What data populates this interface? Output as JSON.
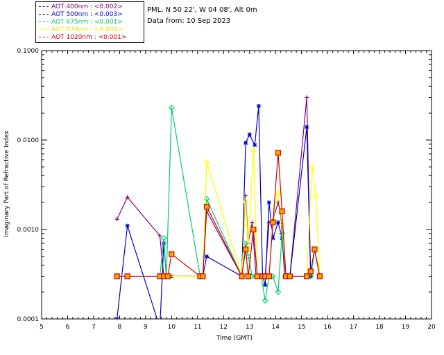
{
  "legend": [
    {
      "label": "AOT  400nm : <0.002>",
      "color": "#800080"
    },
    {
      "label": "AOT  500nm : <0.003>",
      "color": "#0000cc"
    },
    {
      "label": "AOT  675nm : <0.001>",
      "color": "#00cc66"
    },
    {
      "label": "AOT  870nm : <0.002>",
      "color": "#ffff00"
    },
    {
      "label": "AOT 1020nm : <0.001>",
      "color": "#cc0000"
    }
  ],
  "info": {
    "site": "PML, N 50 22', W 04 08', Alt 0m",
    "date": "Data from: 10 Sep 2023"
  },
  "chart_data": {
    "type": "line",
    "xlabel": "Time (GMT)",
    "ylabel": "Imaginary Part of Refractive Index",
    "xlim": [
      5,
      20
    ],
    "ylim": [
      0.0001,
      0.1
    ],
    "yscale": "log",
    "xticks": [
      "5",
      "6",
      "7",
      "8",
      "9",
      "10",
      "11",
      "12",
      "13",
      "14",
      "15",
      "16",
      "17",
      "18",
      "19",
      "20"
    ],
    "yticks": [
      "0.0001",
      "0.0010",
      "0.0100",
      "0.1000"
    ],
    "series": [
      {
        "name": "AOT  400nm",
        "color": "#800080",
        "marker": "plus",
        "points": [
          [
            7.9,
            0.0013
          ],
          [
            8.3,
            0.0023
          ],
          [
            9.55,
            0.00085
          ],
          [
            9.7,
            0.0003
          ],
          [
            9.8,
            0.0003
          ],
          [
            10.0,
            0.0003
          ],
          [
            11.1,
            0.0003
          ],
          [
            11.2,
            0.0003
          ],
          [
            11.35,
            0.0016
          ],
          [
            12.7,
            0.0003
          ],
          [
            12.85,
            0.0024
          ],
          [
            12.95,
            0.0007
          ],
          [
            13.1,
            0.0012
          ],
          [
            13.25,
            0.0003
          ],
          [
            13.45,
            0.0003
          ],
          [
            13.6,
            0.0003
          ],
          [
            13.75,
            0.0012
          ],
          [
            13.9,
            0.0013
          ],
          [
            14.1,
            0.002
          ],
          [
            14.2,
            0.0015
          ],
          [
            14.35,
            0.0003
          ],
          [
            14.55,
            0.0003
          ],
          [
            15.2,
            0.03
          ],
          [
            15.35,
            0.0003
          ],
          [
            15.5,
            0.0006
          ],
          [
            15.7,
            0.0003
          ]
        ]
      },
      {
        "name": "AOT  500nm",
        "color": "#0000cc",
        "marker": "star",
        "points": [
          [
            7.9,
            0.0001
          ],
          [
            8.3,
            0.0011
          ],
          [
            9.55,
            8e-05
          ],
          [
            9.7,
            0.0007
          ],
          [
            9.8,
            0.0003
          ],
          [
            10.0,
            0.0003
          ],
          [
            11.1,
            0.0003
          ],
          [
            11.2,
            0.0003
          ],
          [
            11.35,
            0.0005
          ],
          [
            12.7,
            0.0003
          ],
          [
            12.85,
            0.0093
          ],
          [
            13.0,
            0.0115
          ],
          [
            13.2,
            0.0088
          ],
          [
            13.35,
            0.024
          ],
          [
            13.5,
            0.0003
          ],
          [
            13.6,
            0.00024
          ],
          [
            13.75,
            0.002
          ],
          [
            13.9,
            0.0008
          ],
          [
            14.1,
            0.0012
          ],
          [
            14.25,
            0.0008
          ],
          [
            14.4,
            0.0003
          ],
          [
            14.55,
            0.0003
          ],
          [
            15.2,
            0.014
          ],
          [
            15.35,
            0.0003
          ],
          [
            15.5,
            0.0006
          ],
          [
            15.7,
            0.0003
          ]
        ]
      },
      {
        "name": "AOT  675nm",
        "color": "#00cc66",
        "marker": "diamond",
        "points": [
          [
            9.55,
            0.0003
          ],
          [
            9.7,
            0.0008
          ],
          [
            9.8,
            0.0003
          ],
          [
            10.0,
            0.023
          ],
          [
            11.1,
            0.0003
          ],
          [
            11.2,
            0.0003
          ],
          [
            11.35,
            0.0022
          ],
          [
            12.7,
            0.0003
          ],
          [
            12.85,
            0.0007
          ],
          [
            12.95,
            0.0005
          ],
          [
            13.1,
            0.0003
          ],
          [
            13.25,
            0.0003
          ],
          [
            13.45,
            0.0003
          ],
          [
            13.6,
            0.00016
          ],
          [
            13.75,
            0.0003
          ],
          [
            13.9,
            0.0003
          ],
          [
            14.1,
            0.0002
          ],
          [
            14.25,
            0.0009
          ],
          [
            14.4,
            0.0003
          ],
          [
            14.55,
            0.0003
          ],
          [
            15.2,
            0.0003
          ],
          [
            15.35,
            0.0003
          ],
          [
            15.5,
            0.0006
          ],
          [
            15.7,
            0.0003
          ]
        ]
      },
      {
        "name": "AOT  870nm",
        "color": "#ffff00",
        "marker": "triangle",
        "points": [
          [
            9.55,
            0.0003
          ],
          [
            9.7,
            0.0003
          ],
          [
            9.8,
            0.0003
          ],
          [
            10.0,
            0.0003
          ],
          [
            11.1,
            0.0003
          ],
          [
            11.2,
            0.0003
          ],
          [
            11.35,
            0.0057
          ],
          [
            12.7,
            0.0003
          ],
          [
            12.85,
            0.0021
          ],
          [
            12.95,
            0.0006
          ],
          [
            13.15,
            0.0078
          ],
          [
            13.3,
            0.0003
          ],
          [
            13.45,
            0.0003
          ],
          [
            13.6,
            0.0003
          ],
          [
            13.75,
            0.0003
          ],
          [
            13.9,
            0.0013
          ],
          [
            14.1,
            0.0026
          ],
          [
            14.25,
            0.0012
          ],
          [
            14.4,
            0.0003
          ],
          [
            14.55,
            0.0003
          ],
          [
            15.2,
            0.0003
          ],
          [
            15.4,
            0.0051
          ],
          [
            15.55,
            0.0024
          ],
          [
            15.7,
            0.0003
          ]
        ]
      },
      {
        "name": "AOT 1020nm",
        "color": "#cc0000",
        "marker": "square",
        "points": [
          [
            7.9,
            0.0003
          ],
          [
            8.3,
            0.0003
          ],
          [
            9.55,
            0.0003
          ],
          [
            9.7,
            0.0003
          ],
          [
            9.85,
            0.0003
          ],
          [
            10.0,
            0.00053
          ],
          [
            11.1,
            0.0003
          ],
          [
            11.2,
            0.0003
          ],
          [
            11.35,
            0.0018
          ],
          [
            12.7,
            0.0003
          ],
          [
            12.85,
            0.0006
          ],
          [
            12.95,
            0.0003
          ],
          [
            13.15,
            0.001
          ],
          [
            13.3,
            0.0003
          ],
          [
            13.5,
            0.0003
          ],
          [
            13.6,
            0.0003
          ],
          [
            13.75,
            0.0003
          ],
          [
            13.9,
            0.0012
          ],
          [
            14.1,
            0.0072
          ],
          [
            14.25,
            0.0016
          ],
          [
            14.4,
            0.0003
          ],
          [
            14.55,
            0.0003
          ],
          [
            15.2,
            0.0003
          ],
          [
            15.35,
            0.00034
          ],
          [
            15.5,
            0.0006
          ],
          [
            15.7,
            0.0003
          ]
        ]
      }
    ]
  }
}
